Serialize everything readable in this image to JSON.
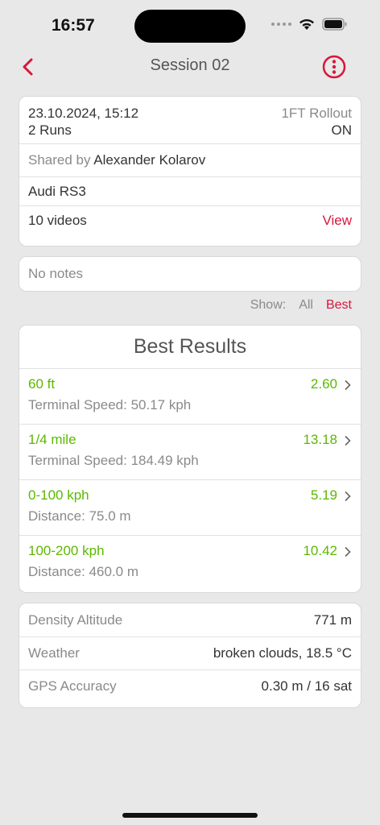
{
  "status_bar": {
    "time": "16:57"
  },
  "nav": {
    "title": "Session 02"
  },
  "session": {
    "date": "23.10.2024, 15:12",
    "rollout_label": "1FT Rollout",
    "runs": "2 Runs",
    "rollout_value": "ON",
    "shared_prefix": "Shared by",
    "shared_by": "Alexander Kolarov",
    "car": "Audi RS3",
    "videos": "10 videos",
    "view_label": "View"
  },
  "notes": {
    "text": "No notes"
  },
  "filter": {
    "show_label": "Show:",
    "all_label": "All",
    "best_label": "Best"
  },
  "results": {
    "title": "Best Results",
    "items": [
      {
        "label": "60 ft",
        "value": "2.60",
        "sub": "Terminal Speed: 50.17 kph"
      },
      {
        "label": "1/4 mile",
        "value": "13.18",
        "sub": "Terminal Speed: 184.49 kph"
      },
      {
        "label": "0-100 kph",
        "value": "5.19",
        "sub": "Distance: 75.0 m"
      },
      {
        "label": "100-200 kph",
        "value": "10.42",
        "sub": "Distance: 460.0 m"
      }
    ]
  },
  "conditions": [
    {
      "label": "Density Altitude",
      "value": "771 m"
    },
    {
      "label": "Weather",
      "value": "broken clouds, 18.5 °C"
    },
    {
      "label": "GPS Accuracy",
      "value": "0.30 m / 16 sat"
    }
  ],
  "colors": {
    "accent": "#d8173a",
    "positive": "#5cb800",
    "background": "#e8e8e8"
  }
}
